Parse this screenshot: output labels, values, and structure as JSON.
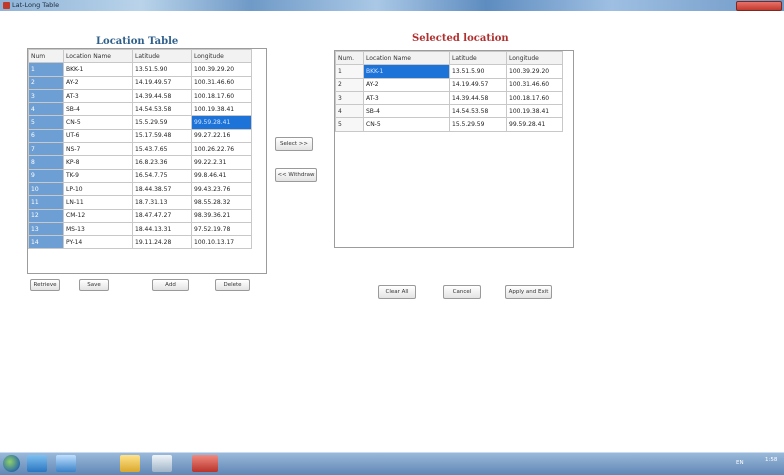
{
  "window": {
    "title": "Lat-Long Table"
  },
  "left": {
    "title": "Location Table",
    "columns": [
      "Num",
      "Location Name",
      "Latitude",
      "Longitude"
    ],
    "rows": [
      [
        "1",
        "BKK-1",
        "13.51.5.90",
        "100.39.29.20"
      ],
      [
        "2",
        "AY-2",
        "14.19.49.57",
        "100.31.46.60"
      ],
      [
        "3",
        "AT-3",
        "14.39.44.58",
        "100.18.17.60"
      ],
      [
        "4",
        "SB-4",
        "14.54.53.58",
        "100.19.38.41"
      ],
      [
        "5",
        "CN-5",
        "15.5.29.59",
        "99.59.28.41"
      ],
      [
        "6",
        "UT-6",
        "15.17.59.48",
        "99.27.22.16"
      ],
      [
        "7",
        "NS-7",
        "15.43.7.65",
        "100.26.22.76"
      ],
      [
        "8",
        "KP-8",
        "16.8.23.36",
        "99.22.2.31"
      ],
      [
        "9",
        "TK-9",
        "16.54.7.75",
        "99.8.46.41"
      ],
      [
        "10",
        "LP-10",
        "18.44.38.57",
        "99.43.23.76"
      ],
      [
        "11",
        "LN-11",
        "18.7.31.13",
        "98.55.28.32"
      ],
      [
        "12",
        "CM-12",
        "18.47.47.27",
        "98.39.36.21"
      ],
      [
        "13",
        "MS-13",
        "18.44.13.31",
        "97.52.19.78"
      ],
      [
        "14",
        "PY-14",
        "19.11.24.28",
        "100.10.13.17"
      ]
    ],
    "buttons": {
      "retrieve": "Retrieve",
      "save": "Save",
      "add": "Add",
      "delete": "Delete"
    }
  },
  "middle": {
    "select": "Select >>",
    "withdraw": "<< Withdraw"
  },
  "right": {
    "title": "Selected location",
    "columns": [
      "Num.",
      "Location Name",
      "Latitude",
      "Longitude"
    ],
    "rows": [
      [
        "1",
        "BKK-1",
        "13.51.5.90",
        "100.39.29.20"
      ],
      [
        "2",
        "AY-2",
        "14.19.49.57",
        "100.31.46.60"
      ],
      [
        "3",
        "AT-3",
        "14.39.44.58",
        "100.18.17.60"
      ],
      [
        "4",
        "SB-4",
        "14.54.53.58",
        "100.19.38.41"
      ],
      [
        "5",
        "CN-5",
        "15.5.29.59",
        "99.59.28.41"
      ]
    ],
    "buttons": {
      "clear_all": "Clear All",
      "cancel": "Cancel",
      "apply_exit": "Apply and Exit"
    }
  },
  "taskbar": {
    "lang": "EN",
    "clock": "1:58"
  }
}
